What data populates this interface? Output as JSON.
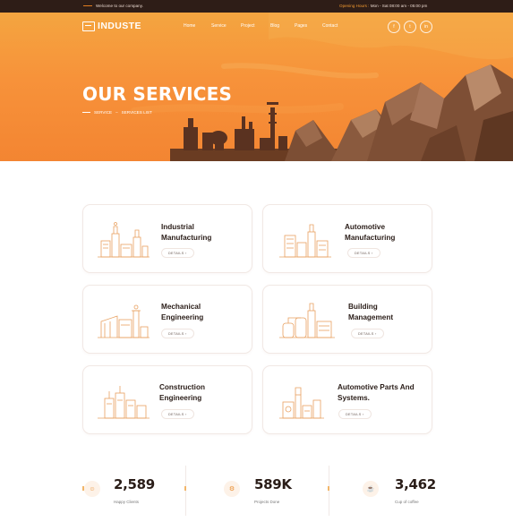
{
  "topbar": {
    "welcome": "Welcome to our company.",
    "hours_label": "Opening Hours :",
    "hours_value": "Mon - Sat 08:00 am - 05:00 pm"
  },
  "brand": {
    "name": "INDUSTE"
  },
  "nav": {
    "items": [
      "Home",
      "Service",
      "Project",
      "Blog",
      "Pages",
      "Contact"
    ]
  },
  "social": {
    "items": [
      "f",
      "t",
      "in"
    ],
    "icons": [
      "facebook-icon",
      "twitter-icon",
      "linkedin-icon"
    ]
  },
  "hero": {
    "title": "OUR SERVICES",
    "breadcrumb": [
      "SERVICE",
      "SERVICES LIST"
    ]
  },
  "services": [
    {
      "title": "Industrial\nManufacturing",
      "details": "DETAILS"
    },
    {
      "title": "Automotive\nManufacturing",
      "details": "DETAILS"
    },
    {
      "title": "Mechanical\nEngineering",
      "details": "DETAILS"
    },
    {
      "title": "Building\nManagement",
      "details": "DETAILS"
    },
    {
      "title": "Construction\nEngineering",
      "details": "DETAILS"
    },
    {
      "title": "Automotive Parts And\nSystems.",
      "details": "DETAILS"
    }
  ],
  "stats": [
    {
      "value": "2,589",
      "label": "Happy Clients",
      "icon": "user-icon"
    },
    {
      "value": "589K",
      "label": "Projects Done",
      "icon": "gear-icon"
    },
    {
      "value": "3,462",
      "label": "Cup of coffee",
      "icon": "coffee-icon"
    }
  ],
  "colors": {
    "accent": "#f38532",
    "dark": "#2e1d17",
    "rock": "#8a5a3e",
    "line": "#e8a060"
  }
}
